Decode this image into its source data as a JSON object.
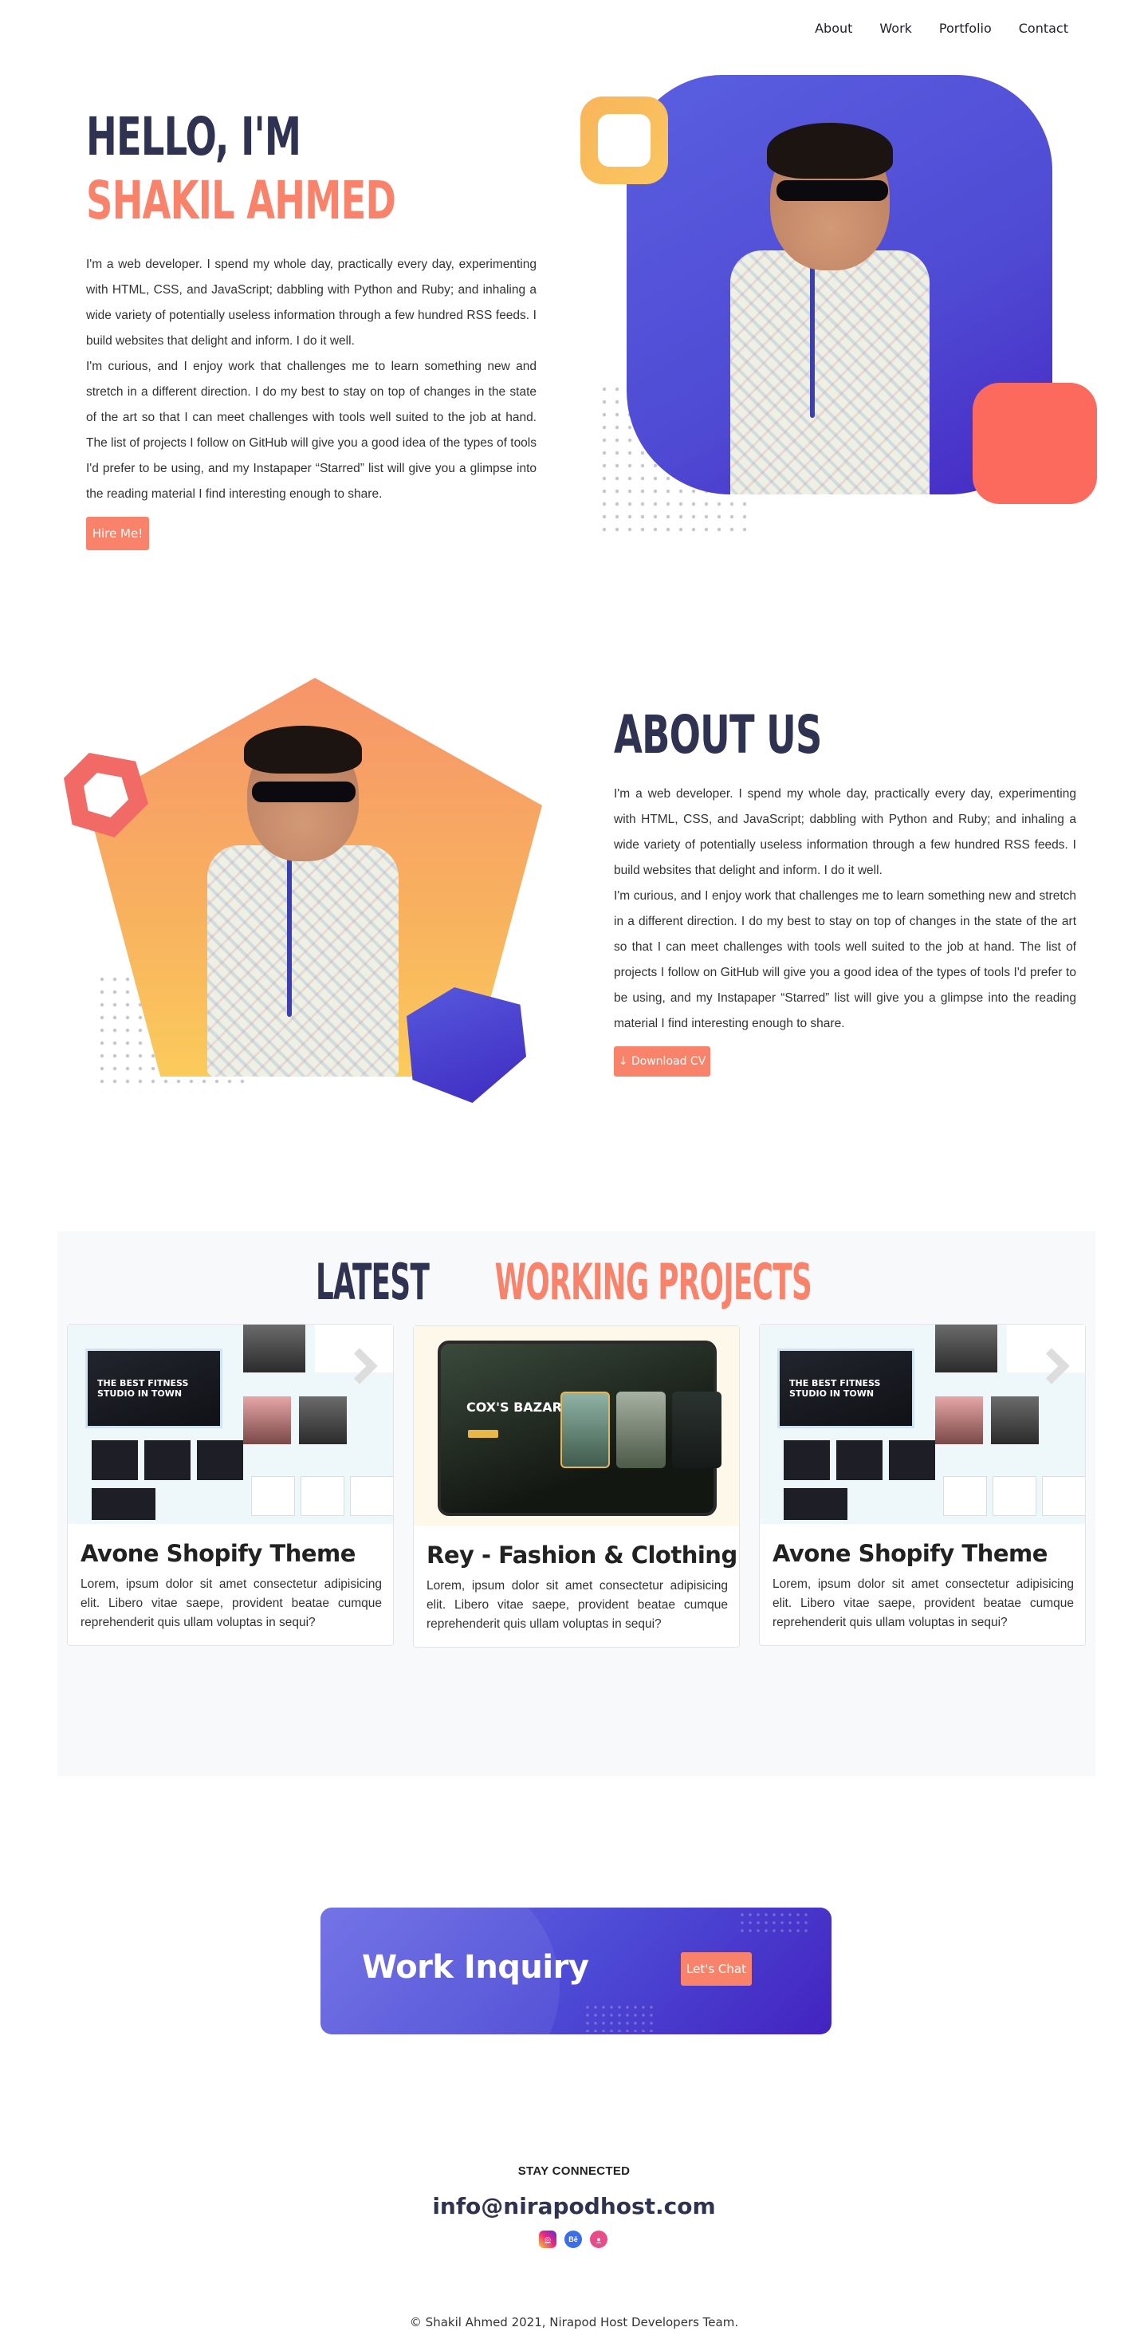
{
  "nav": {
    "items": [
      "About",
      "Work",
      "Portfolio",
      "Contact"
    ]
  },
  "hero": {
    "greeting": "HELLO, I'M",
    "name": "SHAKIL AHMED",
    "paragraph": "I'm a web developer. I spend my whole day, practically every day, experimenting with HTML, CSS, and JavaScript; dabbling with Python and Ruby; and inhaling a wide variety of potentially useless information through a few hundred RSS feeds. I build websites that delight and inform. I do it well.\nI'm curious, and I enjoy work that challenges me to learn something new and stretch in a different direction. I do my best to stay on top of changes in the state of the art so that I can meet challenges with tools well suited to the job at hand. The list of projects I follow on GitHub will give you a good idea of the types of tools I'd prefer to be using, and my Instapaper “Starred” list will give you a glimpse into the reading material I find interesting enough to share.",
    "cta_label": "Hire Me!"
  },
  "about": {
    "title": "ABOUT US",
    "paragraph": "I'm a web developer. I spend my whole day, practically every day, experimenting with HTML, CSS, and JavaScript; dabbling with Python and Ruby; and inhaling a wide variety of potentially useless information through a few hundred RSS feeds. I build websites that delight and inform. I do it well.\nI'm curious, and I enjoy work that challenges me to learn something new and stretch in a different direction. I do my best to stay on top of changes in the state of the art so that I can meet challenges with tools well suited to the job at hand. The list of projects I follow on GitHub will give you a good idea of the types of tools I'd prefer to be using, and my Instapaper “Starred” list will give you a glimpse into the reading material I find interesting enough to share.",
    "cv_icon": "↓",
    "cv_label": "Download CV"
  },
  "projects": {
    "title_dark": "LATEST",
    "title_accent": "WORKING PROJECTS",
    "cards": [
      {
        "title": "Avone Shopify Theme",
        "text": "Lorem, ipsum dolor sit amet consectetur adipisicing elit. Libero vitae saepe, provident beatae cumque reprehenderit quis ullam voluptas in sequi?",
        "thumb_text": "THE BEST FITNESS STUDIO IN TOWN"
      },
      {
        "title": "Rey - Fashion & Clothing",
        "text": "Lorem, ipsum dolor sit amet consectetur adipisicing elit. Libero vitae saepe, provident beatae cumque reprehenderit quis ullam voluptas in sequi?",
        "thumb_text": "COX'S BAZAR"
      },
      {
        "title": "Avone Shopify Theme",
        "text": "Lorem, ipsum dolor sit amet consectetur adipisicing elit. Libero vitae saepe, provident beatae cumque reprehenderit quis ullam voluptas in sequi?",
        "thumb_text": "THE BEST FITNESS STUDIO IN TOWN"
      }
    ]
  },
  "cta": {
    "title": "Work Inquiry",
    "button": "Let's Chat"
  },
  "footer": {
    "stay": "STAY CONNECTED",
    "email": "info@nirapodhost.com",
    "socials": [
      {
        "icon": "instagram-icon"
      },
      {
        "icon": "behance-icon",
        "label": "Bē"
      },
      {
        "icon": "dribbble-icon"
      }
    ],
    "copyright": "© Shakil Ahmed 2021, Nirapod Host Developers Team."
  },
  "colors": {
    "accent": "#f9836a",
    "dark": "#2f3250",
    "purple": "#4f4ad4",
    "yellow": "#fbc661"
  }
}
